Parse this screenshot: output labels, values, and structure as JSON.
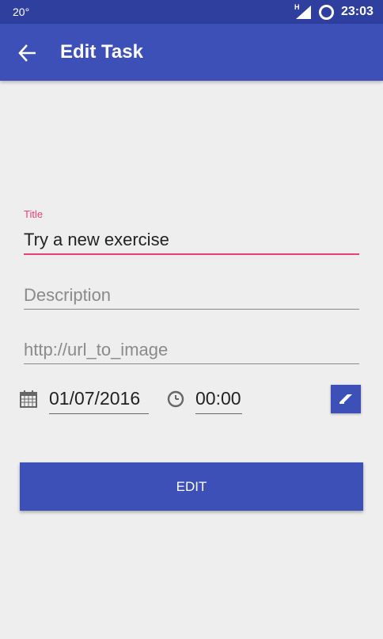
{
  "status_bar": {
    "temperature": "20°",
    "network_type": "H",
    "time": "23:03",
    "icons": [
      "signal-icon",
      "sync-icon"
    ]
  },
  "app_bar": {
    "title": "Edit Task",
    "back_icon": "arrow-back-icon"
  },
  "form": {
    "title_label": "Title",
    "title_value": "Try a new exercise",
    "description_placeholder": "Description",
    "image_url_placeholder": "http://url_to_image",
    "date_value": "01/07/2016",
    "time_value": "00:00",
    "date_icon": "calendar-icon",
    "time_icon": "clock-icon",
    "clear_icon": "eraser-icon"
  },
  "actions": {
    "edit_label": "EDIT"
  },
  "colors": {
    "status_bar": "#2f3f9e",
    "primary": "#3c50b8",
    "accent": "#e8407a",
    "background": "#eeeeee"
  }
}
